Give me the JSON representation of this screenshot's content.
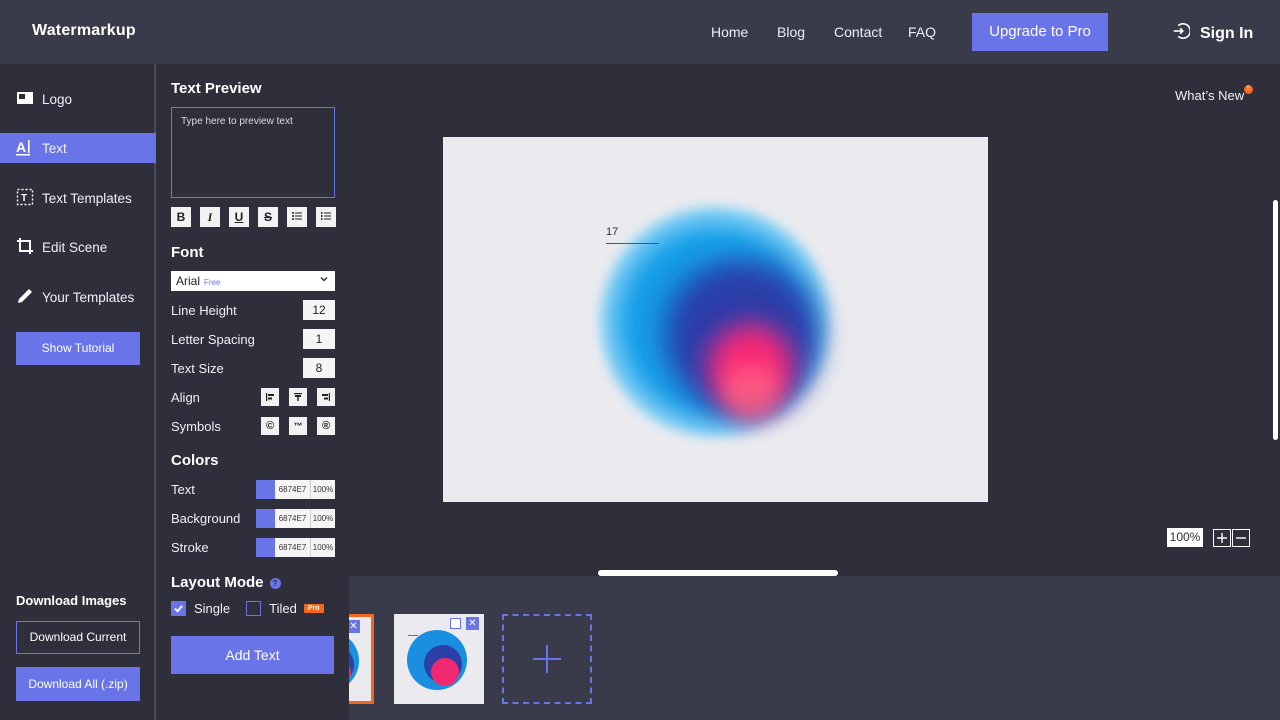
{
  "header": {
    "brand": "Watermarkup",
    "nav": [
      "Home",
      "Blog",
      "Contact",
      "FAQ"
    ],
    "upgrade": "Upgrade to Pro",
    "signin": "Sign In"
  },
  "sidebar": {
    "items": [
      {
        "label": "Logo",
        "icon": "image-icon"
      },
      {
        "label": "Text",
        "icon": "text-icon",
        "active": true
      },
      {
        "label": "Text Templates",
        "icon": "text-template-icon"
      },
      {
        "label": "Edit Scene",
        "icon": "crop-icon"
      },
      {
        "label": "Your Templates",
        "icon": "pen-icon"
      }
    ],
    "tutorial": "Show Tutorial",
    "download_title": "Download Images",
    "download_current": "Download Current",
    "download_all": "Download All (.zip)"
  },
  "panel": {
    "preview_title": "Text Preview",
    "preview_placeholder": "Type here to preview text",
    "format_buttons": [
      "bold",
      "italic",
      "underline",
      "strikethrough",
      "bullet-list",
      "numbered-list"
    ],
    "font_title": "Font",
    "font_value": "Arial",
    "font_tag": "Free",
    "line_height_label": "Line Height",
    "line_height": "12",
    "letter_spacing_label": "Letter Spacing",
    "letter_spacing": "1",
    "text_size_label": "Text Size",
    "text_size": "8",
    "align_label": "Align",
    "symbols_label": "Symbols",
    "symbols": [
      "©",
      "™",
      "®"
    ],
    "colors_title": "Colors",
    "colors": [
      {
        "label": "Text",
        "hex": "6874E7",
        "opacity": "100%",
        "swatch": "#6874e7"
      },
      {
        "label": "Background",
        "hex": "6874E7",
        "opacity": "100%",
        "swatch": "#6874e7"
      },
      {
        "label": "Stroke",
        "hex": "6874E7",
        "opacity": "100%",
        "swatch": "#6874e7"
      }
    ],
    "layout_title": "Layout Mode",
    "layout_single": "Single",
    "layout_tiled": "Tiled",
    "pro_tag": "Pro",
    "add_text": "Add Text"
  },
  "canvas": {
    "whats_new": "What’s New",
    "whats_new_count": "5",
    "watermark_text": "17",
    "zoom": "100%"
  },
  "colors": {
    "accent": "#6874e7",
    "orange": "#f3681e",
    "background": "#2f2f3b",
    "bar": "#3a3b4a"
  }
}
